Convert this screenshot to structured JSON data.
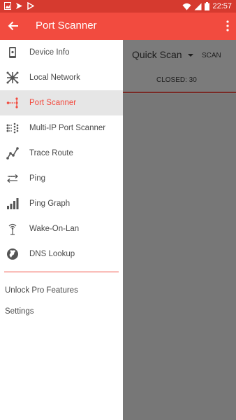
{
  "status_bar": {
    "time": "22:57",
    "left_icons": [
      "photo-icon",
      "send-icon",
      "play-store-icon"
    ],
    "right_icons": [
      "wifi-icon",
      "signal-icon",
      "battery-icon"
    ]
  },
  "toolbar": {
    "title": "Port Scanner",
    "back_icon": "arrow-back-icon",
    "more_icon": "more-vert-icon"
  },
  "drawer": {
    "items": [
      {
        "label": "Device Info",
        "icon": "device-info-icon",
        "active": false
      },
      {
        "label": "Local Network",
        "icon": "local-network-icon",
        "active": false
      },
      {
        "label": "Port Scanner",
        "icon": "port-scanner-icon",
        "active": true
      },
      {
        "label": "Multi-IP Port Scanner",
        "icon": "multi-ip-icon",
        "active": false
      },
      {
        "label": "Trace Route",
        "icon": "trace-route-icon",
        "active": false
      },
      {
        "label": "Ping",
        "icon": "ping-icon",
        "active": false
      },
      {
        "label": "Ping Graph",
        "icon": "ping-graph-icon",
        "active": false
      },
      {
        "label": "Wake-On-Lan",
        "icon": "wake-on-lan-icon",
        "active": false
      },
      {
        "label": "DNS Lookup",
        "icon": "dns-lookup-icon",
        "active": false
      }
    ],
    "footer": [
      {
        "label": "Unlock Pro Features"
      },
      {
        "label": "Settings"
      }
    ]
  },
  "background": {
    "scan_mode": "Quick Scan",
    "scan_button": "SCAN",
    "closed_count": "CLOSED: 30"
  },
  "colors": {
    "accent": "#F24B3F",
    "statusbar": "#D63A2F",
    "active_bg": "#E6E6E6",
    "scrim": "#777777"
  }
}
